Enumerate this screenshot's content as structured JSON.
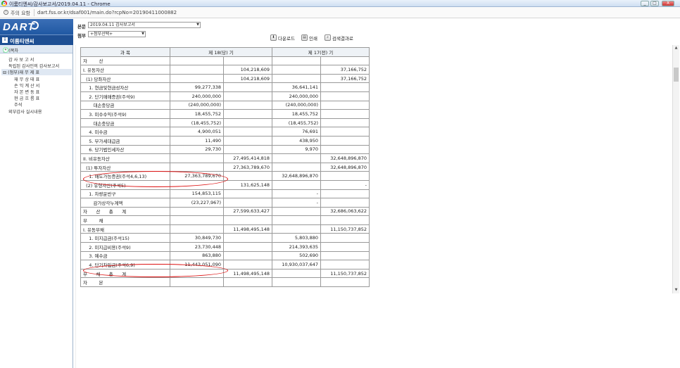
{
  "window": {
    "title": "이룸티엔씨/감사보고서/2019.04.11 - Chrome",
    "min": "_",
    "max": "□",
    "close": "X"
  },
  "address": {
    "warning": "주의 요함",
    "url": "dart.fss.or.kr/dsaf001/main.do?rcpNo=20190411000882"
  },
  "brand": {
    "logo": "DART",
    "company": "이룸티엔씨"
  },
  "toolbar": {
    "doc_label": "본문",
    "doc_value": "2019.04.11  감사보고서",
    "attach_label": "첨부",
    "attach_value": "+첨부선택+",
    "download": "다운로드",
    "print": "인쇄",
    "search": "검색결과로"
  },
  "sidebar": {
    "heading": "문서목차",
    "collapse": "«",
    "items": [
      "감 사 보 고 서",
      "독립된 감사인의 감사보고서",
      "(첨부)재 무 제 표",
      "재 무 상 태 표",
      "손 익 계 산 서",
      "자 본 변 동 표",
      "현 금 흐 름 표",
      "주석",
      "외부감사 실시내용"
    ]
  },
  "table": {
    "headers": [
      "과        목",
      "제 18(당) 기",
      "제 17(전) 기"
    ],
    "rows": [
      [
        "자        산",
        "",
        "",
        "",
        ""
      ],
      [
        "I. 유동자산",
        "",
        "104,218,609",
        "",
        "37,166,752"
      ],
      [
        "  (1) 당좌자산",
        "",
        "104,218,609",
        "",
        "37,166,752"
      ],
      [
        "    1. 현금및현금성자산",
        "99,277,338",
        "",
        "36,641,141",
        ""
      ],
      [
        "    2. 단기매매증권(주석9)",
        "240,000,000",
        "",
        "240,000,000",
        ""
      ],
      [
        "       대손충당금",
        "(240,000,000)",
        "",
        "(240,000,000)",
        ""
      ],
      [
        "    3. 미수수익(주석9)",
        "18,455,752",
        "",
        "18,455,752",
        ""
      ],
      [
        "       대손충당금",
        "(18,455,752)",
        "",
        "(18,455,752)",
        ""
      ],
      [
        "    4. 미수금",
        "4,900,051",
        "",
        "76,691",
        ""
      ],
      [
        "    5. 부가세대급금",
        "11,490",
        "",
        "438,950",
        ""
      ],
      [
        "    6. 당기법인세자산",
        "29,730",
        "",
        "9,970",
        ""
      ],
      [
        "II. 비유동자산",
        "",
        "27,495,414,818",
        "",
        "32,648,896,870"
      ],
      [
        "  (1) 투자자산",
        "",
        "27,363,789,670",
        "",
        "32,648,896,870"
      ],
      [
        "    1. 매도가능증권(주석4,6,13)",
        "27,363,789,670",
        "",
        "32,648,896,870",
        ""
      ],
      [
        "  (2) 유형자산(주석5)",
        "",
        "131,625,148",
        "",
        "-"
      ],
      [
        "    1. 차량운반구",
        "154,853,115",
        "",
        "-",
        ""
      ],
      [
        "       감가상각누계액",
        "(23,227,967)",
        "",
        "-",
        ""
      ],
      [
        "자      산      총      계",
        "",
        "27,599,633,427",
        "",
        "32,686,063,622"
      ],
      [
        "부        채",
        "",
        "",
        "",
        ""
      ],
      [
        "I. 유동부채",
        "",
        "11,498,495,148",
        "",
        "11,150,737,852"
      ],
      [
        "    1. 미지급금(주석15)",
        "30,849,730",
        "",
        "5,803,880",
        ""
      ],
      [
        "    2. 미지급비용(주석9)",
        "23,730,448",
        "",
        "214,393,635",
        ""
      ],
      [
        "    3. 예수금",
        "863,880",
        "",
        "502,690",
        ""
      ],
      [
        "    4. 단기차입금(주석6,9)",
        "11,443,051,090",
        "",
        "10,930,037,647",
        ""
      ],
      [
        "부      채      총      계",
        "",
        "11,498,495,148",
        "",
        "11,150,737,852"
      ],
      [
        "자        본",
        "",
        "",
        "",
        ""
      ]
    ]
  },
  "accent": "#0e4a96",
  "annotation_color": "#dd1111"
}
